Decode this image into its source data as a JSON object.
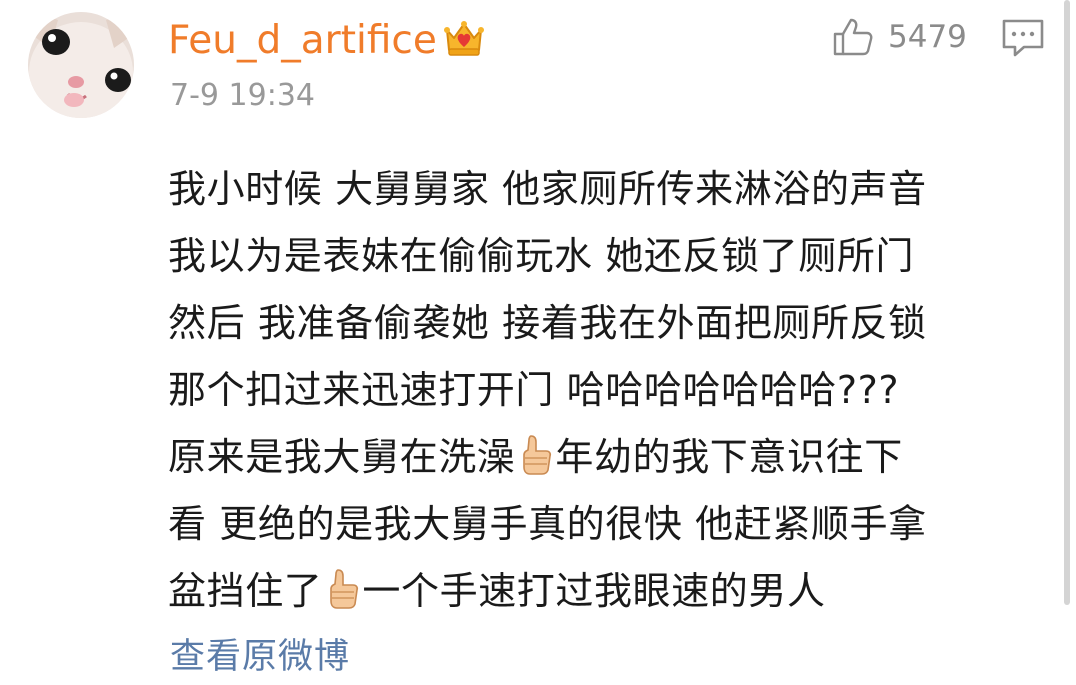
{
  "comment": {
    "user": {
      "name": "Feu_d_artifice",
      "avatar_icon": "kitten-face-avatar",
      "badge_icon": "vip-crown-icon"
    },
    "timestamp": "7-9 19:34",
    "like": {
      "icon": "thumbs-up-outline-icon",
      "count": "5479"
    },
    "reply_icon": "comment-bubble-icon",
    "lines": [
      {
        "parts": [
          "我小时候 大舅舅家 他家厕所传来淋浴的声音"
        ]
      },
      {
        "parts": [
          "我以为是表妹在偷偷玩水 她还反锁了厕所门"
        ]
      },
      {
        "parts": [
          "然后 我准备偷袭她 接着我在外面把厕所反锁"
        ]
      },
      {
        "parts": [
          "那个扣过来迅速打开门 哈哈哈哈哈哈哈???"
        ]
      },
      {
        "parts": [
          "原来是我大舅在洗澡",
          "年幼的我下意识往下"
        ]
      },
      {
        "parts": [
          "看 更绝的是我大舅手真的很快 他赶紧顺手拿"
        ]
      },
      {
        "parts": [
          "盆挡住了",
          "一个手速打过我眼速的男人"
        ]
      }
    ],
    "view_original": "查看原微博"
  },
  "colors": {
    "username": "#f07c2a",
    "timestamp": "#999999",
    "body_text": "#1a1a1a",
    "link": "#5a7ba8",
    "icon_gray": "#8b8b8b"
  }
}
